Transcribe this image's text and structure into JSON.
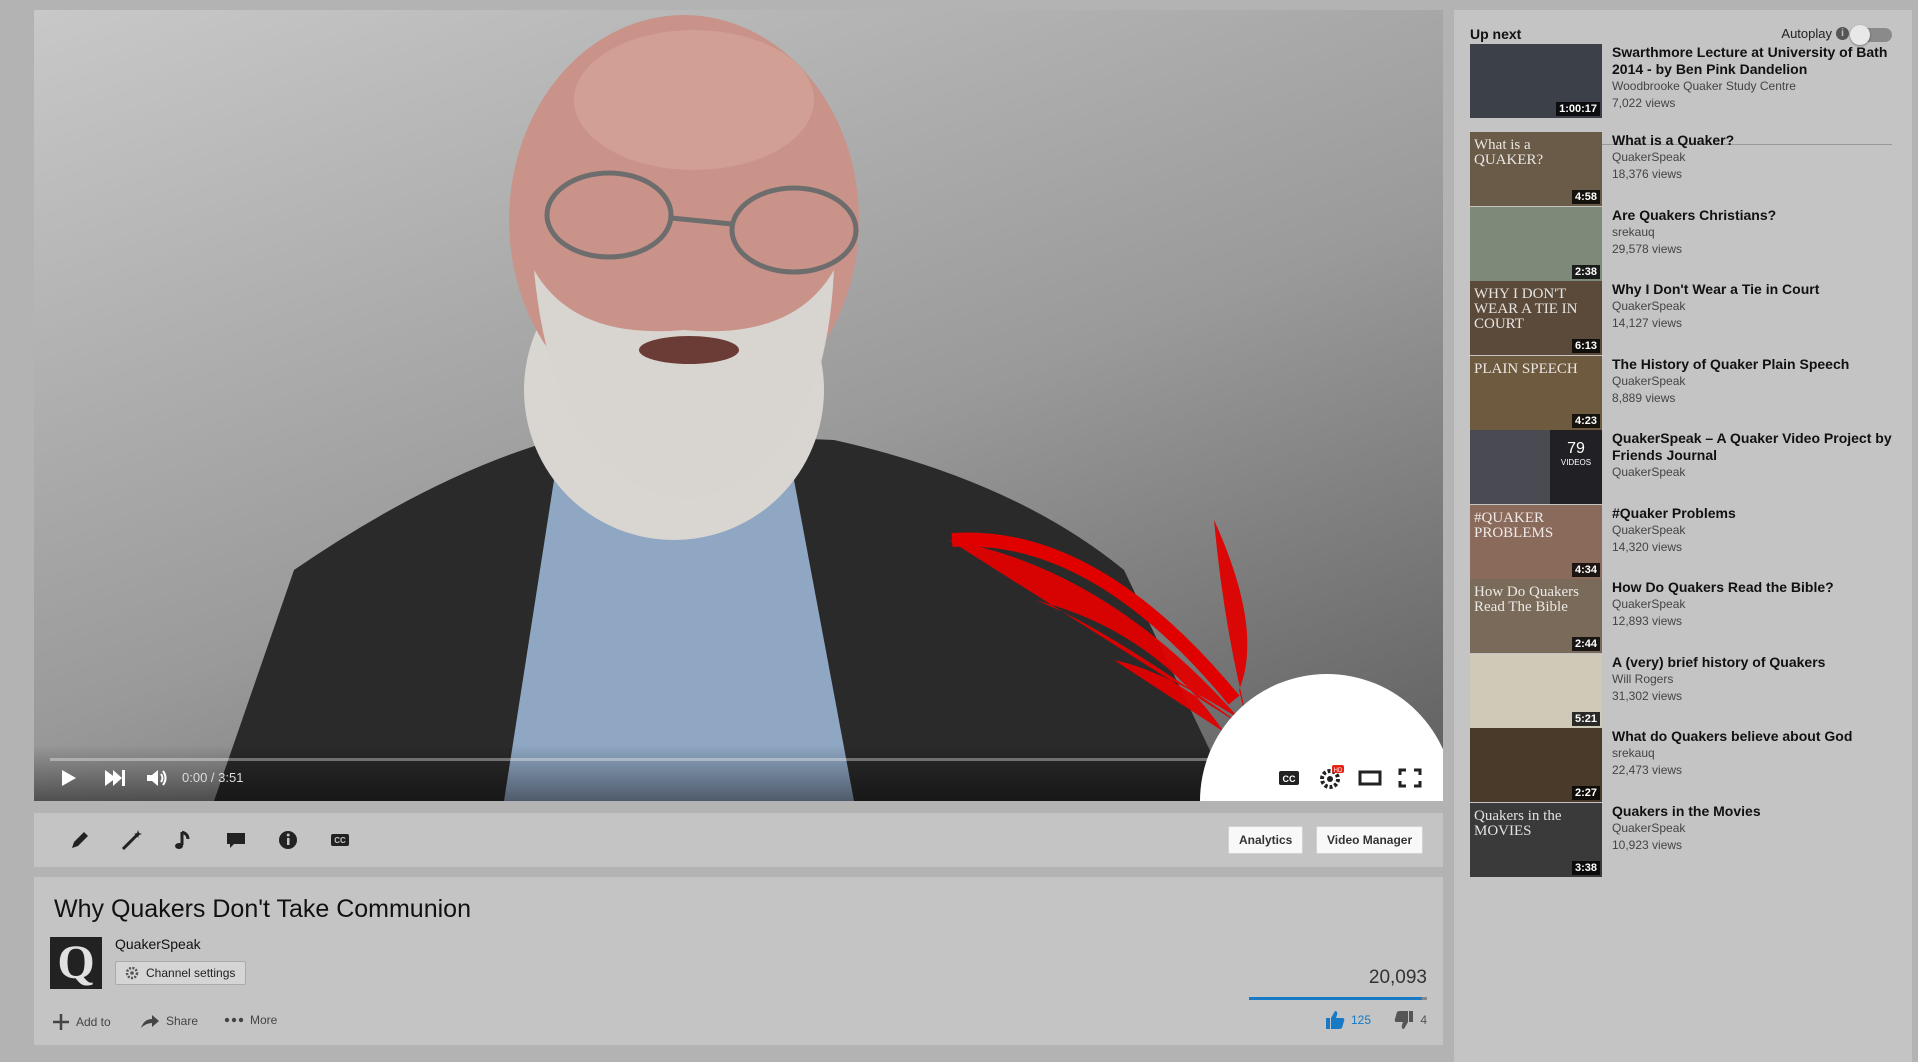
{
  "player": {
    "time_label": "0:00 / 3:51",
    "progress": 0.0
  },
  "toolbar": {
    "analytics_label": "Analytics",
    "video_manager_label": "Video Manager"
  },
  "video": {
    "title": "Why Quakers Don't Take Communion",
    "channel_logo_letter": "Q",
    "channel_name": "QuakerSpeak",
    "channel_settings_label": "Channel settings",
    "views": "20,093",
    "add_to_label": "Add to",
    "share_label": "Share",
    "more_label": "More",
    "likes": "125",
    "dislikes": "4",
    "like_ratio": 0.97
  },
  "sidebar": {
    "up_next_label": "Up next",
    "autoplay_label": "Autoplay",
    "items": [
      {
        "title": "Swarthmore Lecture at University of Bath 2014 - by Ben Pink Dandelion",
        "channel": "Woodbrooke Quaker Study Centre",
        "views": "7,022 views",
        "duration": "1:00:17",
        "thumb_text": ""
      },
      {
        "title": "What is a Quaker?",
        "channel": "QuakerSpeak",
        "views": "18,376 views",
        "duration": "4:58",
        "thumb_text": "What is a QUAKER?"
      },
      {
        "title": "Are Quakers Christians?",
        "channel": "srekauq",
        "views": "29,578 views",
        "duration": "2:38",
        "thumb_text": ""
      },
      {
        "title": "Why I Don't Wear a Tie in Court",
        "channel": "QuakerSpeak",
        "views": "14,127 views",
        "duration": "6:13",
        "thumb_text": "WHY I DON'T WEAR A TIE IN COURT"
      },
      {
        "title": "The History of Quaker Plain Speech",
        "channel": "QuakerSpeak",
        "views": "8,889 views",
        "duration": "4:23",
        "thumb_text": "PLAIN SPEECH"
      },
      {
        "title": "QuakerSpeak – A Quaker Video Project by Friends Journal",
        "channel": "QuakerSpeak",
        "views": "",
        "duration": "",
        "thumb_text": "",
        "playlist_count": "79",
        "playlist_label": "VIDEOS"
      },
      {
        "title": "#Quaker Problems",
        "channel": "QuakerSpeak",
        "views": "14,320 views",
        "duration": "4:34",
        "thumb_text": "#QUAKER PROBLEMS"
      },
      {
        "title": "How Do Quakers Read the Bible?",
        "channel": "QuakerSpeak",
        "views": "12,893 views",
        "duration": "2:44",
        "thumb_text": "How Do Quakers Read The Bible"
      },
      {
        "title": "A (very) brief history of Quakers",
        "channel": "Will Rogers",
        "views": "31,302 views",
        "duration": "5:21",
        "thumb_text": ""
      },
      {
        "title": "What do Quakers believe about God",
        "channel": "srekauq",
        "views": "22,473 views",
        "duration": "2:27",
        "thumb_text": ""
      },
      {
        "title": "Quakers in the Movies",
        "channel": "QuakerSpeak",
        "views": "10,923 views",
        "duration": "3:38",
        "thumb_text": "Quakers in the MOVIES"
      }
    ]
  },
  "colors": {
    "progress_red": "#e62117",
    "like_blue": "#167ac6",
    "arrow_red": "#e00000"
  }
}
